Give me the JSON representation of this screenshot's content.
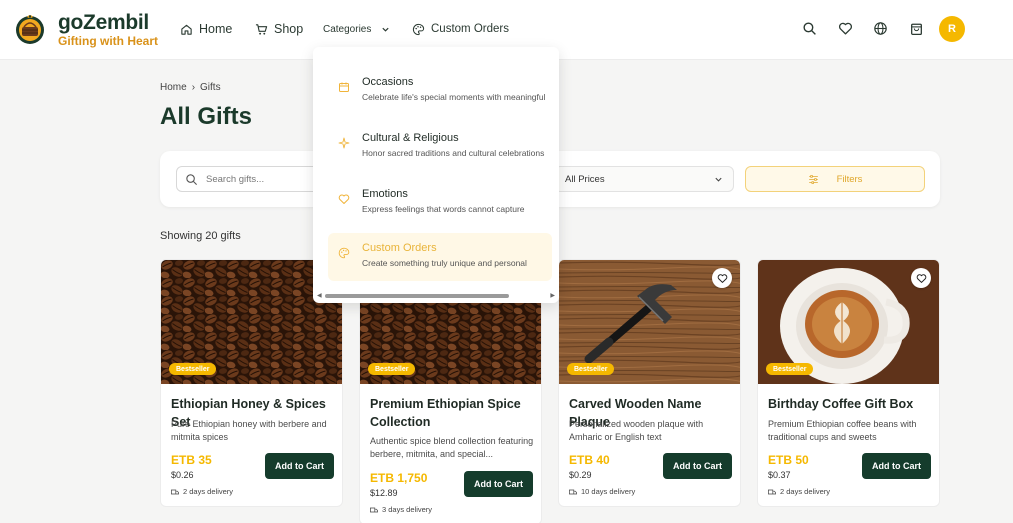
{
  "brand": {
    "name": "goZembil",
    "tagline": "Gifting with Heart"
  },
  "nav": {
    "home": "Home",
    "shop": "Shop",
    "categories": "Categories",
    "custom_orders": "Custom Orders"
  },
  "header": {
    "avatar_initial": "R"
  },
  "breadcrumb": {
    "home": "Home",
    "separator": "›",
    "current": "Gifts"
  },
  "page_title": "All Gifts",
  "filters": {
    "search_placeholder": "Search gifts...",
    "price_select": "All Prices",
    "filters_button": "Filters"
  },
  "results": {
    "showing": "Showing 20 gifts"
  },
  "categories_menu": [
    {
      "title": "Occasions",
      "desc": "Celebrate life's special moments with meaningful",
      "icon": "calendar-icon",
      "active": false
    },
    {
      "title": "Cultural & Religious",
      "desc": "Honor sacred traditions and cultural celebrations",
      "icon": "sparkle-icon",
      "active": false
    },
    {
      "title": "Emotions",
      "desc": "Express feelings that words cannot capture",
      "icon": "heart-icon",
      "active": false
    },
    {
      "title": "Custom Orders",
      "desc": "Create something truly unique and personal",
      "icon": "palette-icon",
      "active": true
    }
  ],
  "products": [
    {
      "title": "Ethiopian Honey & Spices Set",
      "desc": "Pure Ethiopian honey with berbere and mitmita spices",
      "price_etb": "ETB 35",
      "price_usd": "$0.26",
      "delivery": "2 days delivery",
      "badge": "Bestseller",
      "cart_label": "Add to Cart",
      "image": "coffee-beans"
    },
    {
      "title": "Premium Ethiopian Spice Collection",
      "desc": "Authentic spice blend collection featuring berbere, mitmita, and special...",
      "price_etb": "ETB 1,750",
      "price_usd": "$12.89",
      "delivery": "3 days delivery",
      "badge": "Bestseller",
      "cart_label": "Add to Cart",
      "image": "coffee-beans"
    },
    {
      "title": "Carved Wooden Name Plaque",
      "desc": "Personalized wooden plaque with Amharic or English text",
      "price_etb": "ETB 40",
      "price_usd": "$0.29",
      "delivery": "10 days delivery",
      "badge": "Bestseller",
      "cart_label": "Add to Cart",
      "image": "hammer-on-wood"
    },
    {
      "title": "Birthday Coffee Gift Box",
      "desc": "Premium Ethiopian coffee beans with traditional cups and sweets",
      "price_etb": "ETB 50",
      "price_usd": "$0.37",
      "delivery": "2 days delivery",
      "badge": "Bestseller",
      "cart_label": "Add to Cart",
      "image": "latte-cup"
    }
  ],
  "colors": {
    "brand_green": "#153c2c",
    "accent_yellow": "#f5b800",
    "tagline_orange": "#d9921a"
  }
}
